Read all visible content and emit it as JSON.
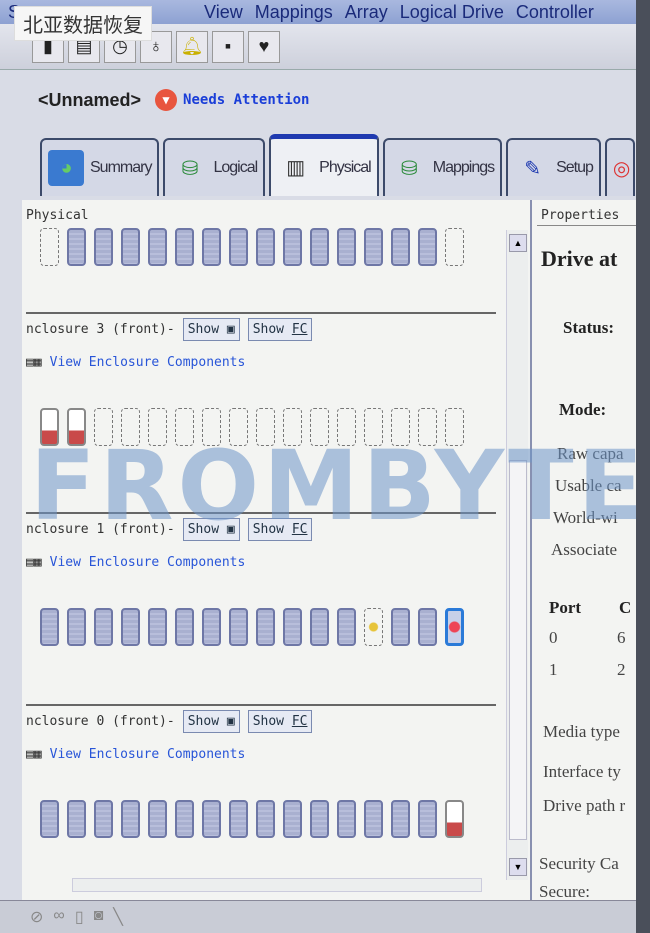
{
  "watermark_label": "北亚数据恢复",
  "watermark_brand": "FROMBYTE",
  "menu": [
    "S",
    "View",
    "Mappings",
    "Array",
    "Logical Drive",
    "Controller"
  ],
  "toolbar_icons": [
    "enclosure-icon",
    "document-icon",
    "clock-icon",
    "stethoscope-icon",
    "alarm-bell-icon",
    "plug-icon",
    "heart-icon"
  ],
  "header": {
    "title": "<Unnamed>",
    "status": "Needs Attention",
    "status_color": "#e8553e"
  },
  "tabs": [
    {
      "label": "Summary"
    },
    {
      "label": "Logical"
    },
    {
      "label": "Physical",
      "active": true
    },
    {
      "label": "Mappings"
    },
    {
      "label": "Setup"
    }
  ],
  "physical": {
    "title": "Physical",
    "enclosures": [
      {
        "name": "",
        "slots": [
          "empty",
          "ok",
          "ok",
          "ok",
          "ok",
          "ok",
          "ok",
          "ok",
          "ok",
          "ok",
          "ok",
          "ok",
          "ok",
          "ok",
          "ok",
          "empty"
        ]
      },
      {
        "name": "nclosure 3 (front)-",
        "show_label": "Show",
        "show_fc_label": "Show",
        "fc": "FC",
        "view_link": "View Enclosure Components",
        "slots": [
          "failed",
          "failed",
          "empty",
          "empty",
          "empty",
          "empty",
          "empty",
          "empty",
          "empty",
          "empty",
          "empty",
          "empty",
          "empty",
          "empty",
          "empty",
          "empty"
        ]
      },
      {
        "name": "nclosure 1 (front)-",
        "show_label": "Show",
        "show_fc_label": "Show",
        "fc": "FC",
        "view_link": "View Enclosure Components",
        "slots": [
          "ok",
          "ok",
          "ok",
          "ok",
          "ok",
          "ok",
          "ok",
          "ok",
          "ok",
          "ok",
          "ok",
          "ok",
          "spare",
          "ok",
          "ok",
          "selected"
        ]
      },
      {
        "name": "nclosure 0 (front)-",
        "show_label": "Show",
        "show_fc_label": "Show",
        "fc": "FC",
        "view_link": "View Enclosure Components",
        "slots": [
          "ok",
          "ok",
          "ok",
          "ok",
          "ok",
          "ok",
          "ok",
          "ok",
          "ok",
          "ok",
          "ok",
          "ok",
          "ok",
          "ok",
          "ok",
          "failed"
        ]
      }
    ]
  },
  "properties": {
    "title": "Properties",
    "heading": "Drive at",
    "status_label": "Status:",
    "mode_label": "Mode:",
    "fields": [
      "Raw capa",
      "Usable ca",
      "World-wi",
      "Associate"
    ],
    "port_header": [
      "Port",
      "C"
    ],
    "port_rows": [
      [
        "0",
        "6"
      ],
      [
        "1",
        "2"
      ]
    ],
    "fields2": [
      "Media type",
      "Interface ty",
      "Drive path r"
    ],
    "fields3": [
      "Security Ca",
      "Secure:"
    ]
  }
}
